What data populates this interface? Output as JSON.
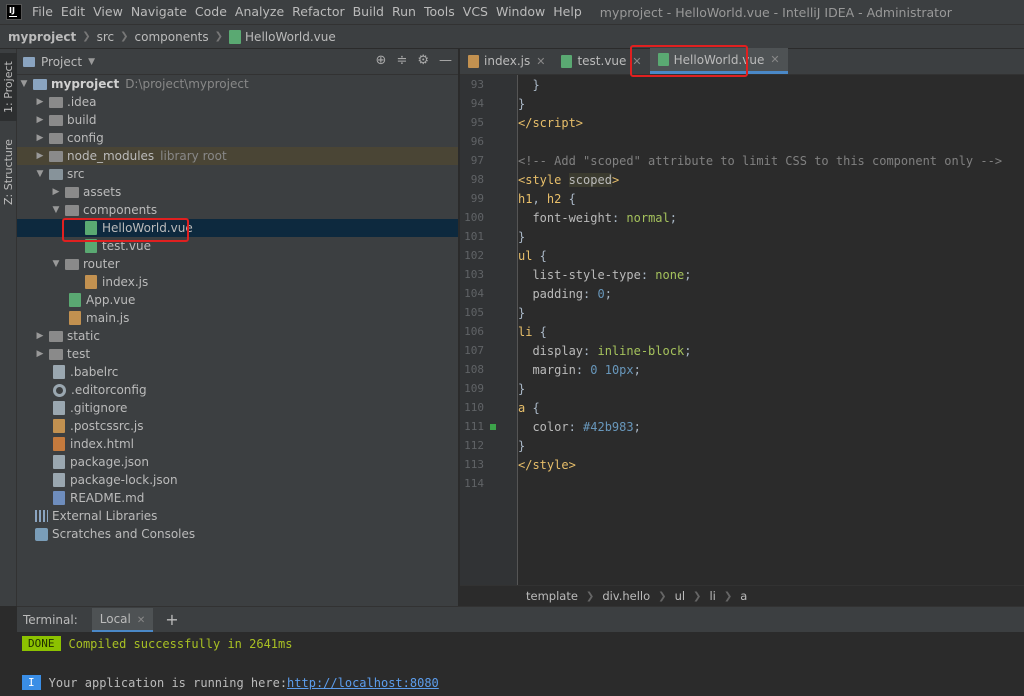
{
  "menubar": {
    "items": [
      "File",
      "Edit",
      "View",
      "Navigate",
      "Code",
      "Analyze",
      "Refactor",
      "Build",
      "Run",
      "Tools",
      "VCS",
      "Window",
      "Help"
    ],
    "window_title": "myproject - HelloWorld.vue - IntelliJ IDEA - Administrator"
  },
  "navbar": {
    "crumbs": [
      "myproject",
      "src",
      "components",
      "HelloWorld.vue"
    ]
  },
  "stripe": {
    "project_tab": "1: Project",
    "structure_tab": "Z: Structure"
  },
  "project_panel": {
    "title": "Project",
    "tree": [
      {
        "label": "myproject",
        "extra": "D:\\project\\myproject"
      },
      {
        "label": ".idea"
      },
      {
        "label": "build"
      },
      {
        "label": "config"
      },
      {
        "label": "node_modules",
        "extra": "library root"
      },
      {
        "label": "src"
      },
      {
        "label": "assets"
      },
      {
        "label": "components"
      },
      {
        "label": "HelloWorld.vue"
      },
      {
        "label": "test.vue"
      },
      {
        "label": "router"
      },
      {
        "label": "index.js"
      },
      {
        "label": "App.vue"
      },
      {
        "label": "main.js"
      },
      {
        "label": "static"
      },
      {
        "label": "test"
      },
      {
        "label": ".babelrc"
      },
      {
        "label": ".editorconfig"
      },
      {
        "label": ".gitignore"
      },
      {
        "label": ".postcssrc.js"
      },
      {
        "label": "index.html"
      },
      {
        "label": "package.json"
      },
      {
        "label": "package-lock.json"
      },
      {
        "label": "README.md"
      },
      {
        "label": "External Libraries"
      },
      {
        "label": "Scratches and Consoles"
      }
    ]
  },
  "editor": {
    "tabs": [
      "index.js",
      "test.vue",
      "HelloWorld.vue"
    ],
    "active_tab": "HelloWorld.vue",
    "line_numbers": [
      "93",
      "94",
      "95",
      "96",
      "97",
      "98",
      "99",
      "100",
      "101",
      "102",
      "103",
      "104",
      "105",
      "106",
      "107",
      "108",
      "109",
      "110",
      "111",
      "112",
      "113",
      "114"
    ],
    "breadcrumbs": [
      "template",
      "div.hello",
      "ul",
      "li",
      "a"
    ]
  },
  "terminal": {
    "label": "Terminal:",
    "tab": "Local",
    "done_badge": "DONE",
    "compiled_msg": "Compiled successfully in 2641ms",
    "info_badge": "I",
    "running_msg": "Your application is running here: ",
    "url": "http://localhost:8080"
  },
  "colors": {
    "highlight": "#e02020",
    "accent": "#4a88c7"
  }
}
